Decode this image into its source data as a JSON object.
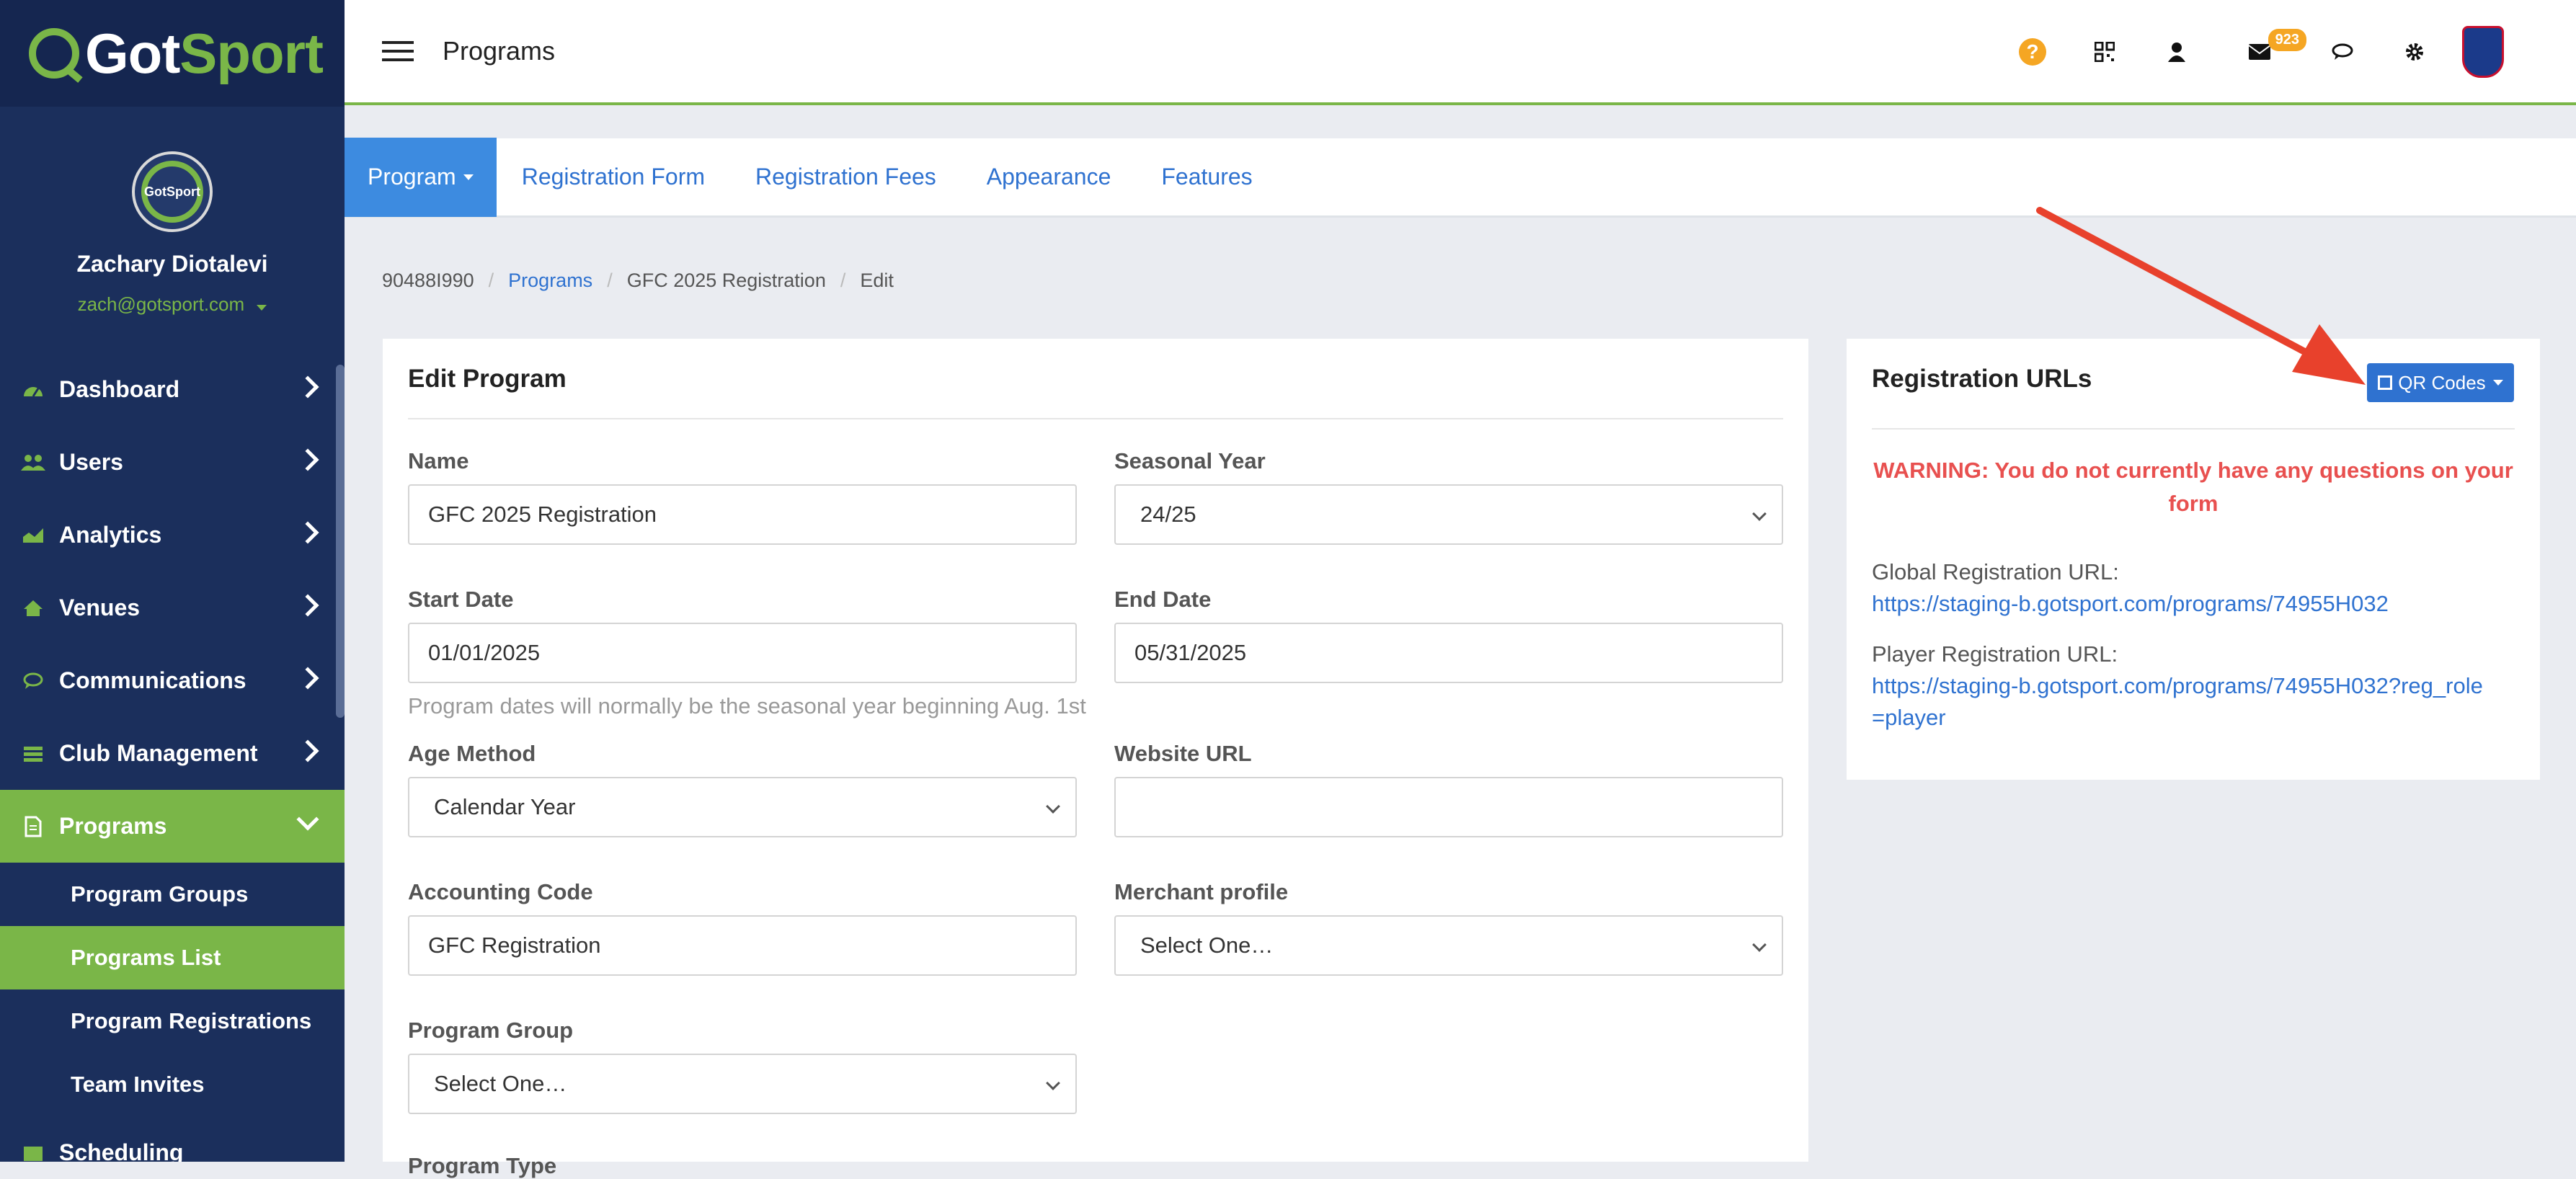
{
  "brand": {
    "logo_part1": "Got",
    "logo_part2": "Sport",
    "avatar_text": "GotSport"
  },
  "user": {
    "name": "Zachary Diotalevi",
    "email": "zach@gotsport.com"
  },
  "sidebar": {
    "items": [
      {
        "label": "Dashboard",
        "icon": "dashboard-icon"
      },
      {
        "label": "Users",
        "icon": "users-icon"
      },
      {
        "label": "Analytics",
        "icon": "analytics-icon"
      },
      {
        "label": "Venues",
        "icon": "home-icon"
      },
      {
        "label": "Communications",
        "icon": "chat-icon"
      },
      {
        "label": "Club Management",
        "icon": "list-icon"
      },
      {
        "label": "Programs",
        "icon": "document-icon"
      }
    ],
    "sub_items": [
      {
        "label": "Program Groups"
      },
      {
        "label": "Programs List"
      },
      {
        "label": "Program Registrations"
      },
      {
        "label": "Team Invites"
      }
    ],
    "cut_off_label": "Scheduling"
  },
  "header": {
    "title": "Programs",
    "message_count": "923"
  },
  "tabs": [
    {
      "label": "Program"
    },
    {
      "label": "Registration Form"
    },
    {
      "label": "Registration Fees"
    },
    {
      "label": "Appearance"
    },
    {
      "label": "Features"
    }
  ],
  "breadcrumb": {
    "id": "90488I990",
    "programs": "Programs",
    "program": "GFC 2025 Registration",
    "current": "Edit"
  },
  "edit_program": {
    "title": "Edit Program",
    "name_label": "Name",
    "name_value": "GFC 2025 Registration",
    "seasonal_year_label": "Seasonal Year",
    "seasonal_year_value": "24/25",
    "start_date_label": "Start Date",
    "start_date_value": "01/01/2025",
    "end_date_label": "End Date",
    "end_date_value": "05/31/2025",
    "dates_help": "Program dates will normally be the seasonal year beginning Aug. 1st",
    "age_method_label": "Age Method",
    "age_method_value": "Calendar Year",
    "website_url_label": "Website URL",
    "website_url_value": "",
    "accounting_code_label": "Accounting Code",
    "accounting_code_value": "GFC Registration",
    "merchant_profile_label": "Merchant profile",
    "merchant_profile_value": "Select One…",
    "program_group_label": "Program Group",
    "program_group_value": "Select One…",
    "cut_off_label": "Program Type"
  },
  "registration_urls": {
    "title": "Registration URLs",
    "qr_button": "QR Codes",
    "warning": "WARNING: You do not currently have any questions on your form",
    "global_label": "Global Registration URL:",
    "global_url": "https://staging-b.gotsport.com/programs/74955H032",
    "player_label": "Player Registration URL:",
    "player_url": "https://staging-b.gotsport.com/programs/74955H032?reg_role=player"
  },
  "colors": {
    "sidebar_bg": "#1b2f5c",
    "accent_green": "#7ab648",
    "link_blue": "#2f72d0",
    "warning_red": "#e8504f",
    "badge_orange": "#f5a623",
    "arrow_red": "#e8412c"
  }
}
